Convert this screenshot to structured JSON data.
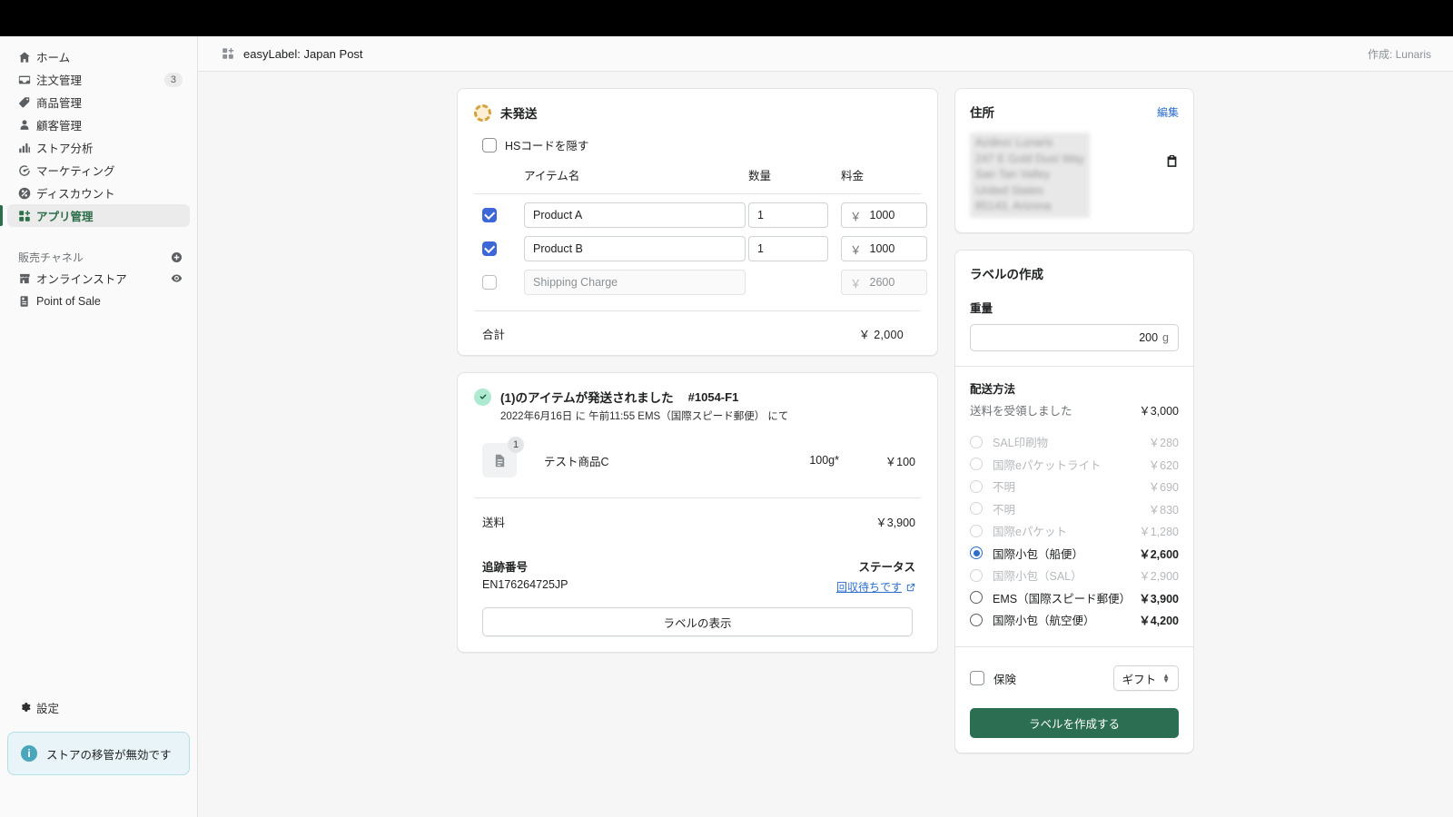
{
  "sidebar": {
    "items": [
      {
        "label": "ホーム",
        "icon": "home-icon",
        "badge": ""
      },
      {
        "label": "注文管理",
        "icon": "orders-icon",
        "badge": "3"
      },
      {
        "label": "商品管理",
        "icon": "products-icon",
        "badge": ""
      },
      {
        "label": "顧客管理",
        "icon": "customers-icon",
        "badge": ""
      },
      {
        "label": "ストア分析",
        "icon": "analytics-icon",
        "badge": ""
      },
      {
        "label": "マーケティング",
        "icon": "marketing-icon",
        "badge": ""
      },
      {
        "label": "ディスカウント",
        "icon": "discounts-icon",
        "badge": ""
      },
      {
        "label": "アプリ管理",
        "icon": "apps-icon",
        "badge": ""
      }
    ],
    "section_label": "販売チャネル",
    "channels": [
      {
        "label": "オンラインストア",
        "icon": "store-icon"
      },
      {
        "label": "Point of Sale",
        "icon": "pos-icon"
      }
    ],
    "settings_label": "設定",
    "notice": "ストアの移管が無効です",
    "accent_color": "#2c6e49"
  },
  "topbar": {
    "title": "easyLabel: Japan Post",
    "author": "作成: Lunaris"
  },
  "unfulfilled": {
    "status_label": "未発送",
    "hide_hs_label": "HSコードを隠す",
    "hide_hs_checked": false,
    "columns": {
      "name": "アイテム名",
      "qty": "数量",
      "price": "料金"
    },
    "rows": [
      {
        "checked": true,
        "disabled": false,
        "name": "Product A",
        "name_placeholder": "",
        "qty": "1",
        "currency": "￥",
        "price": "1000"
      },
      {
        "checked": true,
        "disabled": false,
        "name": "Product B",
        "name_placeholder": "",
        "qty": "1",
        "currency": "￥",
        "price": "1000"
      },
      {
        "checked": false,
        "disabled": true,
        "name": "",
        "name_placeholder": "Shipping Charge",
        "qty": "",
        "currency": "￥",
        "price": "2600"
      }
    ],
    "total_label": "合計",
    "total_value": "￥  2,000"
  },
  "fulfilled": {
    "title": "(1)のアイテムが発送されました",
    "fulfillment_id": "#1054-F1",
    "subtitle": "2022年6月16日 に 午前11:55 EMS（国際スピード郵便） にて",
    "item": {
      "qty_badge": "1",
      "name": "テスト商品C",
      "weight": "100g*",
      "price": "￥100"
    },
    "shipping_label": "送料",
    "shipping_value": "￥3,900",
    "tracking_label": "追跡番号",
    "tracking_number": "EN176264725JP",
    "status_label": "ステータス",
    "status_value": "回収待ちです",
    "view_label_button": "ラベルの表示"
  },
  "address_card": {
    "title": "住所",
    "edit_label": "編集",
    "lines": [
      "Azdevc Lunaris",
      "247 E Gold Dust Way",
      "San Tan Valley",
      "United States",
      "85143, Arizona"
    ]
  },
  "label_panel": {
    "title": "ラベルの作成",
    "weight_label": "重量",
    "weight_value": "200",
    "weight_unit": "g",
    "method_label": "配送方法",
    "collected_label": "送料を受領しました",
    "collected_value": "￥3,000",
    "options": [
      {
        "label": "SAL印刷物",
        "price": "￥280",
        "state": "disabled"
      },
      {
        "label": "国際eパケットライト",
        "price": "￥620",
        "state": "disabled"
      },
      {
        "label": "不明",
        "price": "￥690",
        "state": "disabled"
      },
      {
        "label": "不明",
        "price": "￥830",
        "state": "disabled"
      },
      {
        "label": "国際eパケット",
        "price": "￥1,280",
        "state": "disabled"
      },
      {
        "label": "国際小包（船便）",
        "price": "￥2,600",
        "state": "selected"
      },
      {
        "label": "国際小包（SAL）",
        "price": "￥2,900",
        "state": "disabled"
      },
      {
        "label": "EMS（国際スピード郵便）",
        "price": "￥3,900",
        "state": "enabled"
      },
      {
        "label": "国際小包（航空便）",
        "price": "￥4,200",
        "state": "enabled"
      }
    ],
    "insurance_label": "保険",
    "insurance_checked": false,
    "select_value": "ギフト",
    "create_button": "ラベルを作成する",
    "primary_color": "#2c6e51"
  }
}
